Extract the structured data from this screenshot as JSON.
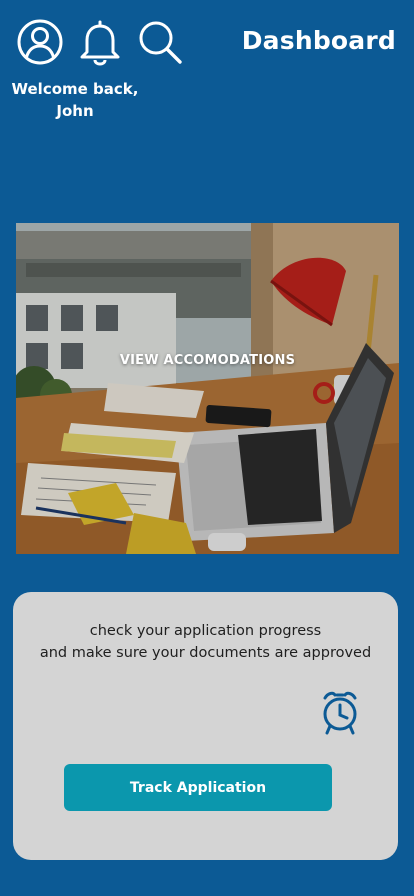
{
  "header": {
    "title": "Dashboard",
    "welcome_line1": "Welcome back,",
    "welcome_line2": "John",
    "icons": [
      "profile-icon",
      "bell-icon",
      "search-icon"
    ]
  },
  "hero": {
    "label": "VIEW ACCOMODATIONS"
  },
  "progress_card": {
    "line1": "check your application progress",
    "line2": "and make sure your documents are approved",
    "icon": "alarm-clock-icon",
    "button_label": "Track Application"
  },
  "colors": {
    "background": "#0c5a95",
    "card": "#d4d4d4",
    "button": "#0b97ad",
    "icon_accent": "#0c5a95"
  }
}
